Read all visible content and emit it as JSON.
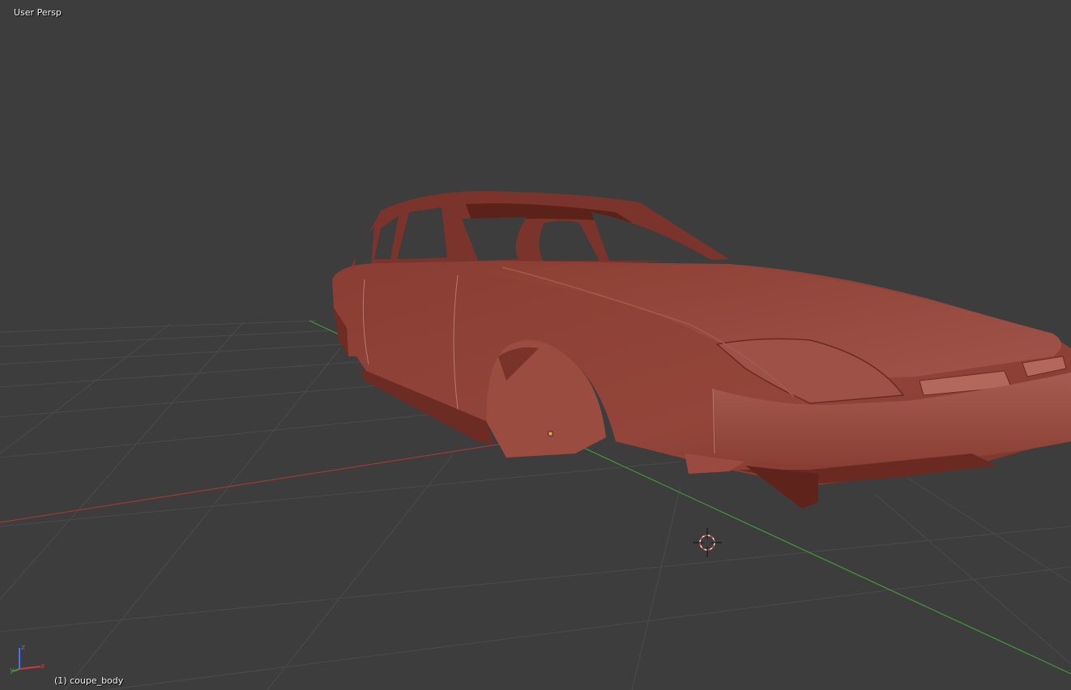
{
  "viewport": {
    "view_label": "User Persp",
    "object_label": "(1) coupe_body"
  },
  "colors": {
    "background": "#3d3d3d",
    "grid": "#4a4a4a",
    "x_axis": "#a33a3a",
    "y_axis": "#4aa040",
    "z_axis": "#4a6cff",
    "mesh": "#8a3d33"
  },
  "axis_gizmo": {
    "labels": [
      "x",
      "y",
      "z"
    ]
  }
}
